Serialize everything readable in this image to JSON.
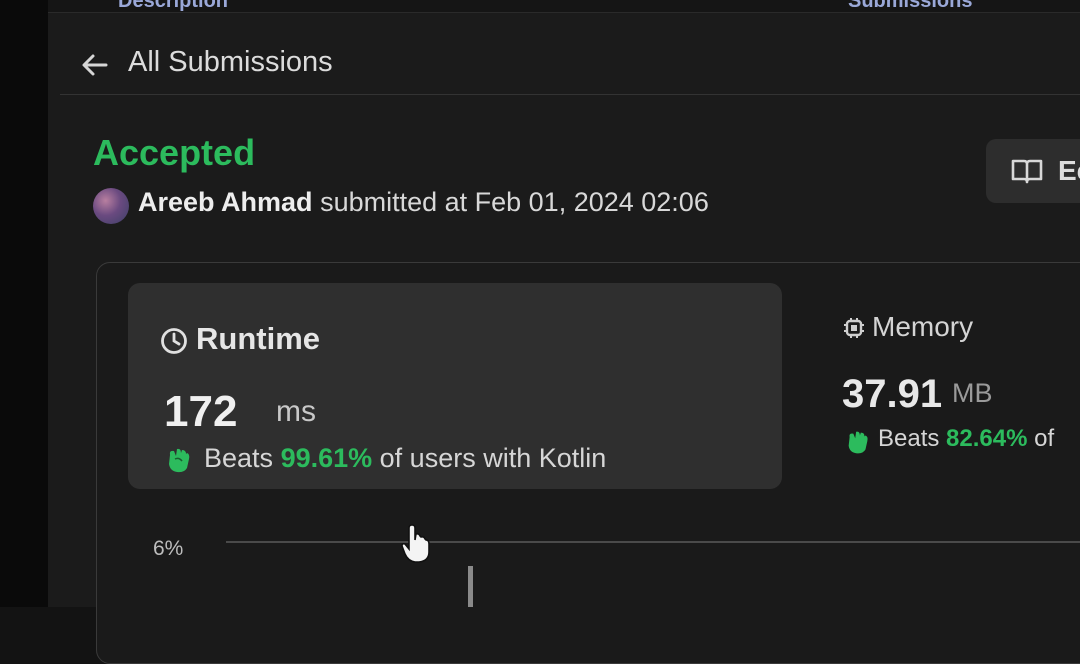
{
  "tabs": [
    {
      "label": "Description"
    },
    {
      "label": "Submissions"
    }
  ],
  "header": {
    "back_label": "All Submissions"
  },
  "submission": {
    "status": "Accepted",
    "user": "Areeb Ahmad",
    "submitted_text": "submitted at Feb 01, 2024 02:06"
  },
  "editorial": {
    "label": "Editorial",
    "visible_label": "Ec"
  },
  "runtime": {
    "title": "Runtime",
    "value": "172",
    "unit": "ms",
    "beats_prefix": "Beats",
    "beats_pct": "99.61%",
    "beats_suffix": "of users with Kotlin"
  },
  "memory": {
    "title": "Memory",
    "value": "37.91",
    "unit": "MB",
    "beats_prefix": "Beats",
    "beats_pct": "82.64%",
    "beats_suffix": "of"
  },
  "distribution": {
    "axis_label": "6%"
  },
  "colors": {
    "accepted": "#2cbb5d",
    "background": "#1b1b1b",
    "card": "#2f2f2f"
  },
  "icons": {
    "back": "arrow-left-icon",
    "runtime": "clock-icon",
    "memory": "chip-icon",
    "beats": "hand-clap-icon",
    "editorial": "book-open-icon"
  }
}
